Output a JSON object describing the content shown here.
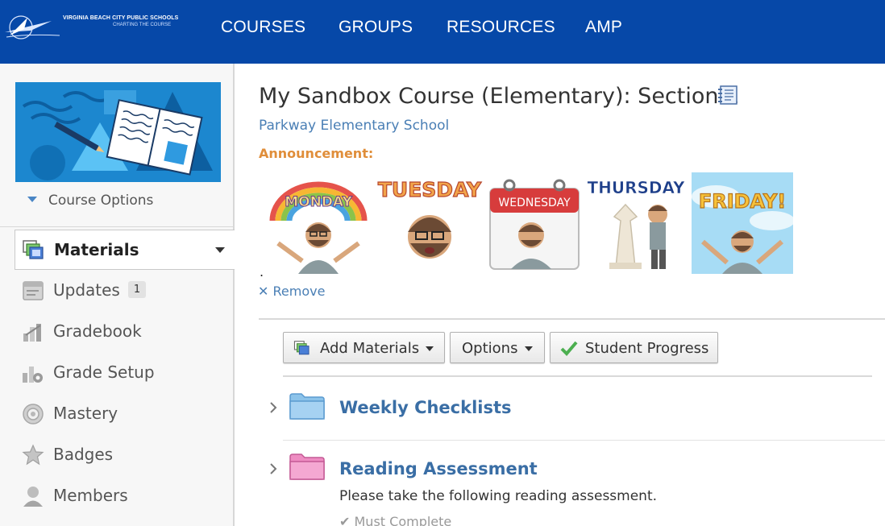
{
  "header": {
    "logo_line1": "VIRGINIA BEACH CITY PUBLIC SCHOOLS",
    "logo_line2": "CHARTING THE COURSE",
    "nav": [
      "COURSES",
      "GROUPS",
      "RESOURCES",
      "AMP"
    ]
  },
  "sidebar": {
    "course_options": "Course Options",
    "items": [
      {
        "label": "Materials",
        "icon": "materials-icon",
        "active": true
      },
      {
        "label": "Updates",
        "icon": "updates-icon",
        "count": "1"
      },
      {
        "label": "Gradebook",
        "icon": "gradebook-icon"
      },
      {
        "label": "Grade Setup",
        "icon": "grade-setup-icon"
      },
      {
        "label": "Mastery",
        "icon": "mastery-icon"
      },
      {
        "label": "Badges",
        "icon": "badges-icon"
      },
      {
        "label": "Members",
        "icon": "members-icon"
      }
    ]
  },
  "course": {
    "title": "My Sandbox Course (Elementary): Section 1",
    "school": "Parkway Elementary School",
    "announcement_label": "Announcement:",
    "bitmoji_words": [
      "MONDAY",
      "TUESDAY",
      "WEDNESDAY",
      "THURSDAY",
      "FRIDAY!"
    ],
    "dot": ".",
    "remove_label": "Remove"
  },
  "toolbar": {
    "add_materials": "Add Materials",
    "options": "Options",
    "student_progress": "Student Progress"
  },
  "materials": [
    {
      "title": "Weekly Checklists",
      "folder_color": "#7fb8e6"
    },
    {
      "title": "Reading Assessment",
      "folder_color": "#ee8cc2",
      "description": "Please take the following reading assessment.",
      "requirement": "Must Complete"
    }
  ],
  "colors": {
    "header_bg": "#0648a8",
    "link": "#4a7fb5",
    "announcement": "#e08e3a"
  }
}
